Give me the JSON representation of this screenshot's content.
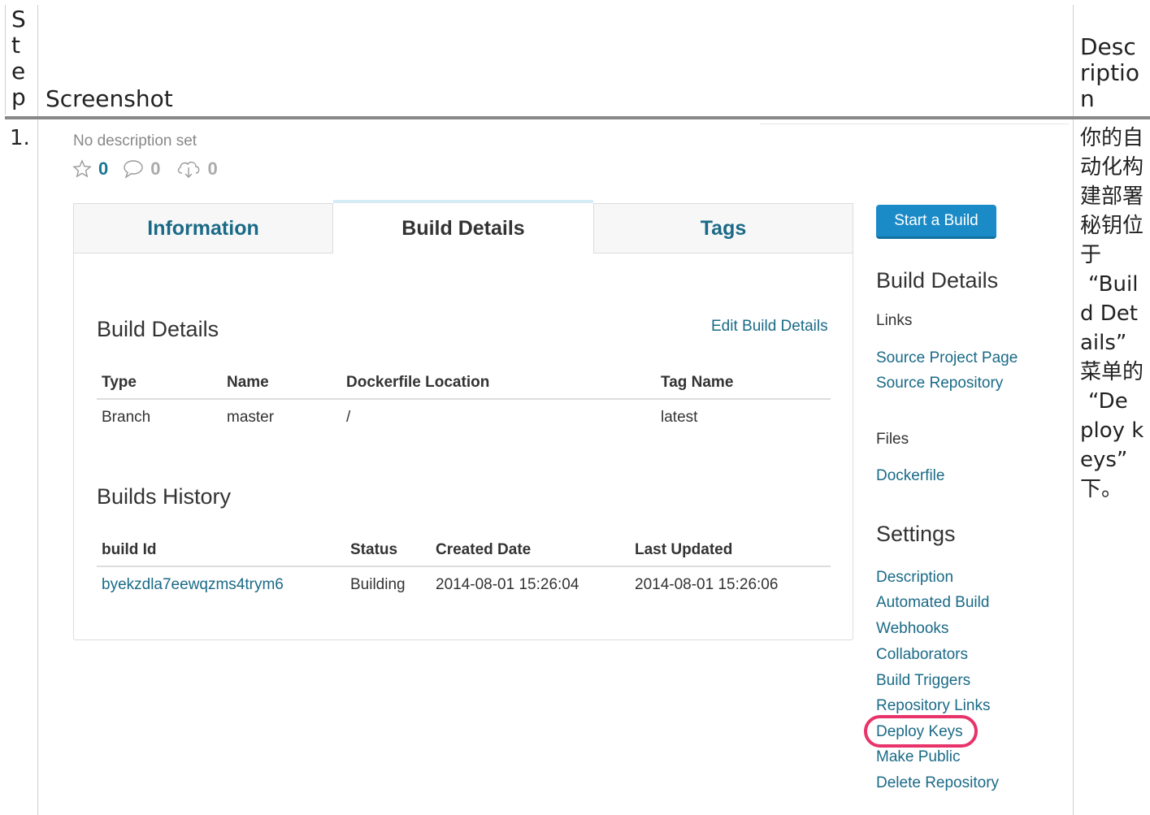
{
  "table": {
    "header_step": [
      "S",
      "t",
      "e",
      "p"
    ],
    "header_screenshot": "Screenshot",
    "header_description": [
      "Desc",
      "riptio",
      "n"
    ],
    "step_number": "1.",
    "description_lines": [
      "你的自",
      "动化构",
      "建部署",
      "秘钥位",
      "于",
      "“Buil",
      "d Det",
      "ails”",
      "菜单的",
      "“De",
      "ploy k",
      "eys”",
      "下。"
    ]
  },
  "repo": {
    "no_description": "No description set",
    "stars": "0",
    "comments": "0",
    "downloads": "0"
  },
  "tabs": [
    "Information",
    "Build Details",
    "Tags"
  ],
  "active_tab": "Build Details",
  "build_details": {
    "title": "Build Details",
    "edit_link": "Edit Build Details",
    "columns": [
      "Type",
      "Name",
      "Dockerfile Location",
      "Tag Name"
    ],
    "rows": [
      [
        "Branch",
        "master",
        "/",
        "latest"
      ]
    ]
  },
  "builds_history": {
    "title": "Builds History",
    "columns": [
      "build Id",
      "Status",
      "Created Date",
      "Last Updated"
    ],
    "rows": [
      [
        "byekzdla7eewqzms4trym6",
        "Building",
        "2014-08-01 15:26:04",
        "2014-08-01 15:26:06"
      ]
    ]
  },
  "sidebar": {
    "start_build": "Start a Build",
    "build_details_title": "Build Details",
    "links_label": "Links",
    "links": [
      "Source Project Page",
      "Source Repository"
    ],
    "files_label": "Files",
    "files": [
      "Dockerfile"
    ],
    "settings_title": "Settings",
    "settings": [
      "Description",
      "Automated Build",
      "Webhooks",
      "Collaborators",
      "Build Triggers",
      "Repository Links",
      "Deploy Keys",
      "Make Public",
      "Delete Repository"
    ]
  },
  "colors": {
    "accent": "#1a6a87",
    "button": "#1b8bc7",
    "highlight": "#e8336b"
  }
}
